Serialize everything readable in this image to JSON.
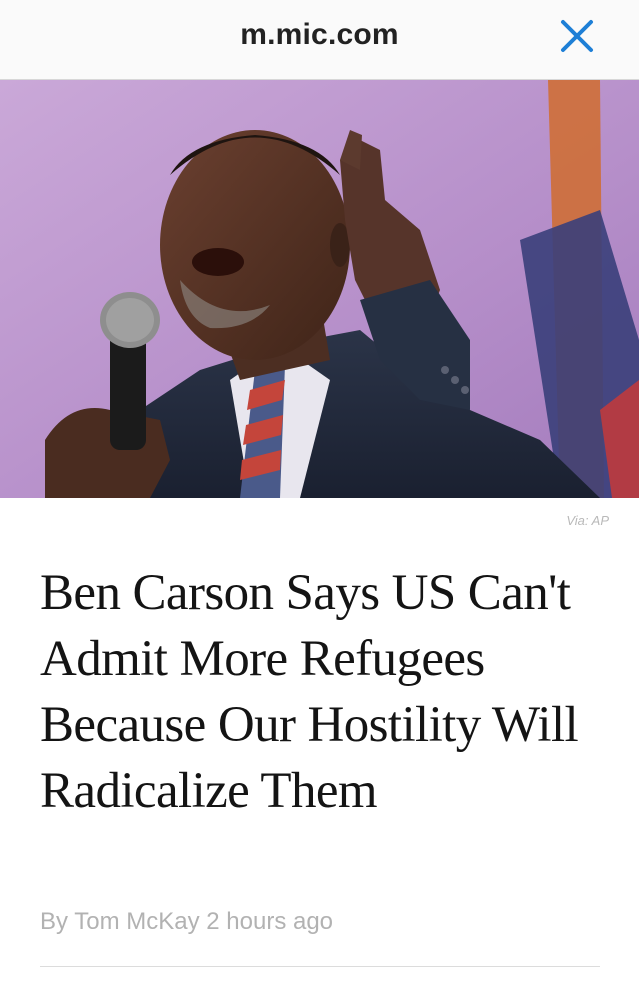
{
  "browser": {
    "url": "m.mic.com",
    "close_icon": "close-icon"
  },
  "article": {
    "image_alt": "Ben Carson speaking into a microphone",
    "image_credit": "Via: AP",
    "headline": "Ben Carson Says US Can't Admit More Refugees Because Our Hostility Will Radicalize Them",
    "byline": "By Tom McKay 2 hours ago"
  },
  "colors": {
    "accent": "#1e7fd6",
    "muted_text": "#b2b2b2",
    "backdrop": "#b991cc"
  }
}
